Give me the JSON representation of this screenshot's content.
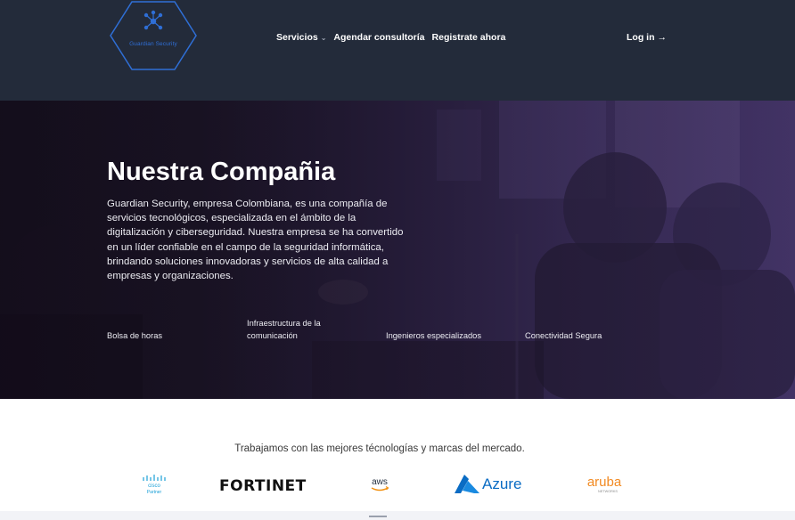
{
  "header": {
    "logo_text": "Guardian Security",
    "nav": [
      {
        "label": "Servicios",
        "has_dropdown": true
      },
      {
        "label": "Agendar consultoría",
        "has_dropdown": false
      },
      {
        "label": "Registrate ahora",
        "has_dropdown": false
      }
    ],
    "login_label": "Log in",
    "login_arrow": "→"
  },
  "hero": {
    "title": "Nuestra Compañia",
    "description": "Guardian Security, empresa Colombiana, es una compañía de servicios tecnológicos, especializada en el ámbito de la digitalización y ciberseguridad. Nuestra empresa se ha convertido en un líder confiable en el campo de la seguridad informática, brindando soluciones innovadoras y servicios de alta calidad a empresas y organizaciones.",
    "features": [
      "Bolsa de horas",
      "Infraestructura de la comunicación",
      "Ingenieros especializados",
      "Conectividad Segura"
    ]
  },
  "brands": {
    "title": "Trabajamos con las mejores técnologías y marcas del mercado.",
    "logos": [
      {
        "icon": "cisco-logo-icon",
        "text": "cisco",
        "sub": "Partner"
      },
      {
        "icon": "fortinet-logo-icon",
        "text": "FORTINET"
      },
      {
        "icon": "aws-logo-icon",
        "text": "aws"
      },
      {
        "icon": "azure-logo-icon",
        "text": "Azure"
      },
      {
        "icon": "aruba-logo-icon",
        "text": "aruba",
        "sub": "NETWORKS"
      }
    ]
  },
  "colors": {
    "header_bg": "#232b3a",
    "logo_blue": "#2f6fd6",
    "hero_purple": "#433466",
    "azure_blue": "#0a6cc4",
    "aruba_orange": "#f28a22"
  }
}
